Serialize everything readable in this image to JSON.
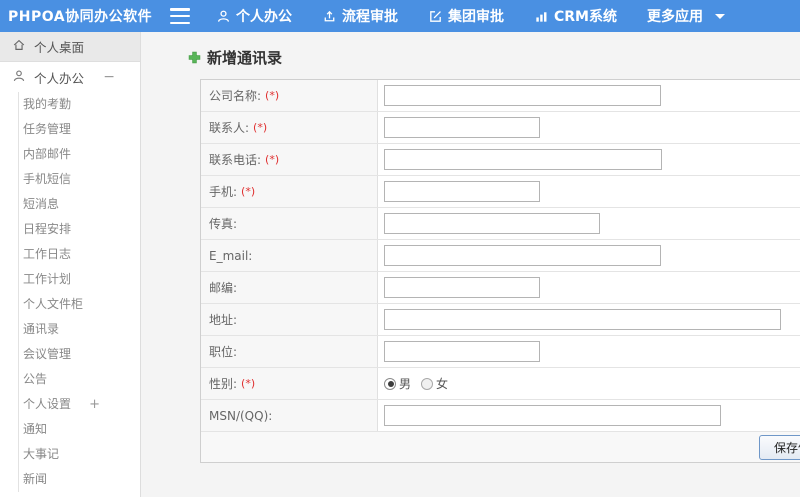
{
  "header": {
    "logo": "PHPOA协同办公软件",
    "nav": [
      {
        "label": "个人办公",
        "icon": "user-icon"
      },
      {
        "label": "流程审批",
        "icon": "upload-icon"
      },
      {
        "label": "集团审批",
        "icon": "edit-icon"
      },
      {
        "label": "CRM系统",
        "icon": "bar-chart-icon"
      },
      {
        "label": "更多应用",
        "icon": "caret-down-icon"
      }
    ]
  },
  "sidebar": {
    "desktop_label": "个人桌面",
    "section_label": "个人办公",
    "collapse_mark": "−",
    "expand_mark": "+",
    "items": [
      "我的考勤",
      "任务管理",
      "内部邮件",
      "手机短信",
      "短消息",
      "日程安排",
      "工作日志",
      "工作计划",
      "个人文件柜",
      "通讯录",
      "会议管理",
      "公告",
      "个人设置",
      "通知",
      "大事记",
      "新闻"
    ]
  },
  "main": {
    "title": "新增通讯录",
    "required_mark": "(*)",
    "form": {
      "rows": [
        {
          "label": "公司名称:",
          "required": true
        },
        {
          "label": "联系人:",
          "required": true
        },
        {
          "label": "联系电话:",
          "required": true
        },
        {
          "label": "手机:",
          "required": true
        },
        {
          "label": "传真:",
          "required": false
        },
        {
          "label": "E_mail:",
          "required": false
        },
        {
          "label": "邮编:",
          "required": false
        },
        {
          "label": "地址:",
          "required": false
        },
        {
          "label": "职位:",
          "required": false
        },
        {
          "label": "性别:",
          "required": true
        },
        {
          "label": "MSN/(QQ):",
          "required": false
        }
      ],
      "gender": {
        "male": "男",
        "female": "女"
      },
      "save_label": "保存信息"
    }
  }
}
